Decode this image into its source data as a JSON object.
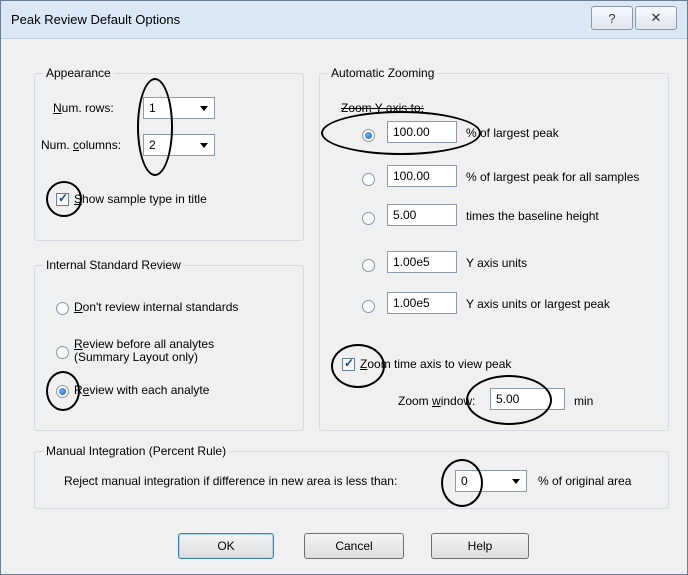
{
  "window": {
    "title": "Peak Review Default Options",
    "help_glyph": "?",
    "close_glyph": "✕"
  },
  "appearance": {
    "legend": "Appearance",
    "num_rows": {
      "label_key": "N",
      "label_rest": "um. rows:",
      "value": "1"
    },
    "num_columns": {
      "label_pre": "Num. ",
      "label_key": "c",
      "label_rest": "olumns:",
      "value": "2"
    },
    "show_sample_type": {
      "label_key": "S",
      "label_rest": "how sample type in title",
      "checked": true
    }
  },
  "internal_standard": {
    "legend": "Internal Standard Review",
    "options": [
      {
        "key": "D",
        "rest": "on't review internal standards",
        "selected": false
      },
      {
        "key": "R",
        "rest": "eview before all analytes",
        "line2": "(Summary Layout only)",
        "selected": false
      },
      {
        "pre": "R",
        "key": "e",
        "rest": "view with each analyte",
        "selected": true
      }
    ]
  },
  "auto_zoom": {
    "legend": "Automatic Zooming",
    "zoom_y_label": "Zoom Y axis to:",
    "options": [
      {
        "value": "100.00",
        "label": "% of largest peak",
        "selected": true
      },
      {
        "value": "100.00",
        "label": "% of largest peak for all samples",
        "selected": false
      },
      {
        "value": "5.00",
        "label": "times the baseline height",
        "selected": false
      },
      {
        "value": "1.00e5",
        "label": "Y axis units",
        "selected": false
      },
      {
        "value": "1.00e5",
        "label": "Y axis units or largest peak",
        "selected": false
      }
    ],
    "zoom_time": {
      "label_key": "Z",
      "label_rest": "oom time axis to view peak",
      "checked": true
    },
    "zoom_window": {
      "label_pre": "Zoom ",
      "label_key": "w",
      "label_rest": "indow:",
      "value": "5.00",
      "unit": "min"
    }
  },
  "manual_integration": {
    "legend": "Manual Integration (Percent Rule)",
    "label": "Reject manual integration if difference in new area is less than:",
    "value": "0",
    "unit": "% of original area"
  },
  "buttons": {
    "ok": "OK",
    "cancel": "Cancel",
    "help": "Help"
  }
}
